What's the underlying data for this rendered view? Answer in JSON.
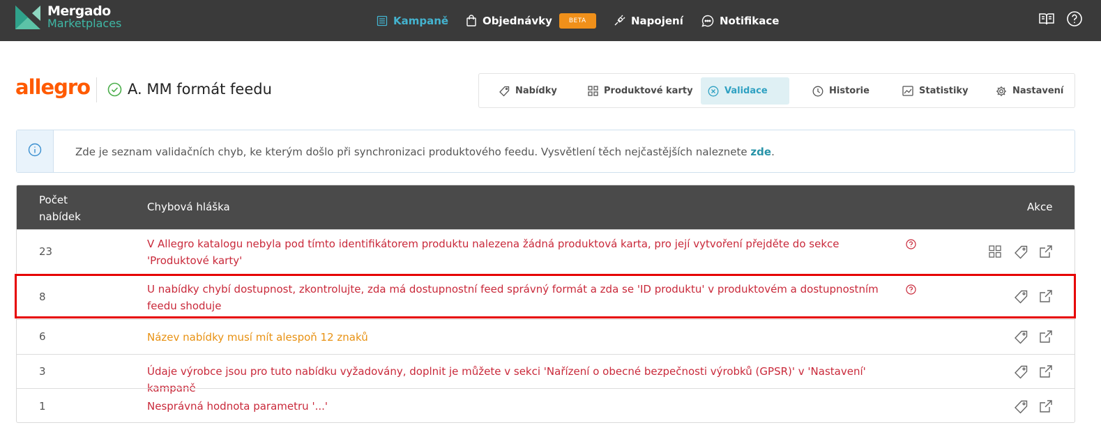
{
  "app": {
    "logo_line1": "Mergado",
    "logo_line2": "Marketplaces"
  },
  "nav": {
    "campaigns": "Kampaně",
    "orders": "Objednávky",
    "beta": "BETA",
    "connections": "Napojení",
    "notifications": "Notifikace"
  },
  "header": {
    "brand": "allegro",
    "campaign_name": "A. MM formát feedu"
  },
  "tabs": [
    {
      "label": "Nabídky",
      "icon": "tag-icon"
    },
    {
      "label": "Produktové karty",
      "icon": "grid-icon"
    },
    {
      "label": "Validace",
      "icon": "circle-x-icon",
      "active": true
    },
    {
      "label": "Historie",
      "icon": "clock-icon"
    },
    {
      "label": "Statistiky",
      "icon": "chart-icon"
    },
    {
      "label": "Nastavení",
      "icon": "gear-icon"
    }
  ],
  "info": {
    "text": "Zde je seznam validačních chyb, ke kterým došlo při synchronizaci produktového feedu. Vysvětlení těch nejčastějších naleznete ",
    "link": "zde",
    "after": "."
  },
  "table": {
    "col_count": "Počet\nnabídek",
    "col_message": "Chybová hláška",
    "col_actions": "Akce",
    "rows": [
      {
        "count": "23",
        "message": "V Allegro katalogu nebyla pod tímto identifikátorem produktu nalezena žádná produktová karta, pro její vytvoření přejděte do sekce 'Produktové karty'",
        "severity": "error",
        "help": true,
        "actions": [
          "grid-icon",
          "tag-icon",
          "external-link-icon"
        ]
      },
      {
        "count": "8",
        "message": "U nabídky chybí dostupnost, zkontrolujte, zda má dostupnostní feed správný formát a zda se 'ID produktu' v produktovém a dostupnostním feedu shoduje",
        "severity": "error",
        "help": true,
        "actions": [
          "tag-icon",
          "external-link-icon"
        ],
        "highlighted": true
      },
      {
        "count": "6",
        "message": "Název nabídky musí mít alespoň 12 znaků",
        "severity": "warning",
        "help": false,
        "actions": [
          "tag-icon",
          "external-link-icon"
        ]
      },
      {
        "count": "3",
        "message": "Údaje výrobce jsou pro tuto nabídku vyžadovány, doplnit je můžete v sekci 'Nařízení o obecné bezpečnosti výrobků (GPSR)' v 'Nastavení' kampaně",
        "severity": "error",
        "help": false,
        "actions": [
          "tag-icon",
          "external-link-icon"
        ]
      },
      {
        "count": "1",
        "message": "Nesprávná hodnota parametru '...'",
        "severity": "error",
        "help": false,
        "actions": [
          "tag-icon",
          "external-link-icon"
        ]
      }
    ]
  },
  "colors": {
    "topbar": "#3a3a3a",
    "accent": "#44b3cf",
    "brand": "#ff5a00",
    "error": "#c9293a",
    "warning": "#e89112",
    "beta": "#f0901a"
  }
}
